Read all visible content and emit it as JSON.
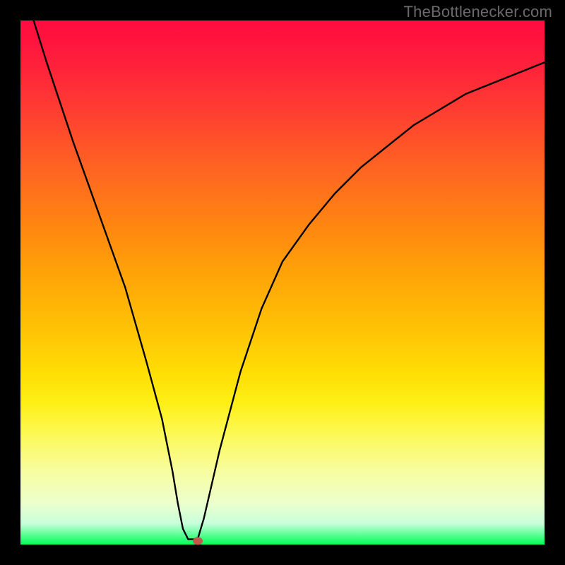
{
  "attribution": "TheBottlenecker.com",
  "chart_data": {
    "type": "line",
    "title": "",
    "xlabel": "",
    "ylabel": "",
    "xlim": [
      0,
      100
    ],
    "ylim": [
      0,
      100
    ],
    "series": [
      {
        "name": "curve",
        "x": [
          2.5,
          5,
          10,
          15,
          20,
          24,
          27,
          29,
          30,
          31,
          32,
          33.8,
          35,
          38,
          42,
          46,
          50,
          55,
          60,
          65,
          70,
          75,
          80,
          85,
          90,
          95,
          100
        ],
        "y": [
          100,
          92,
          77,
          63,
          49,
          35,
          24,
          14,
          8,
          3,
          1,
          1,
          5,
          18,
          33,
          45,
          54,
          61,
          67,
          72,
          76,
          80,
          83,
          86,
          88,
          90,
          92
        ]
      }
    ],
    "marker": {
      "x": 33.8,
      "y": 0.7
    },
    "background": {
      "type": "vertical-gradient",
      "stops": [
        {
          "pos": 0.0,
          "color": "#ff0b40"
        },
        {
          "pos": 0.5,
          "color": "#ffb507"
        },
        {
          "pos": 0.78,
          "color": "#fcfb64"
        },
        {
          "pos": 1.0,
          "color": "#02fd5c"
        }
      ]
    }
  }
}
